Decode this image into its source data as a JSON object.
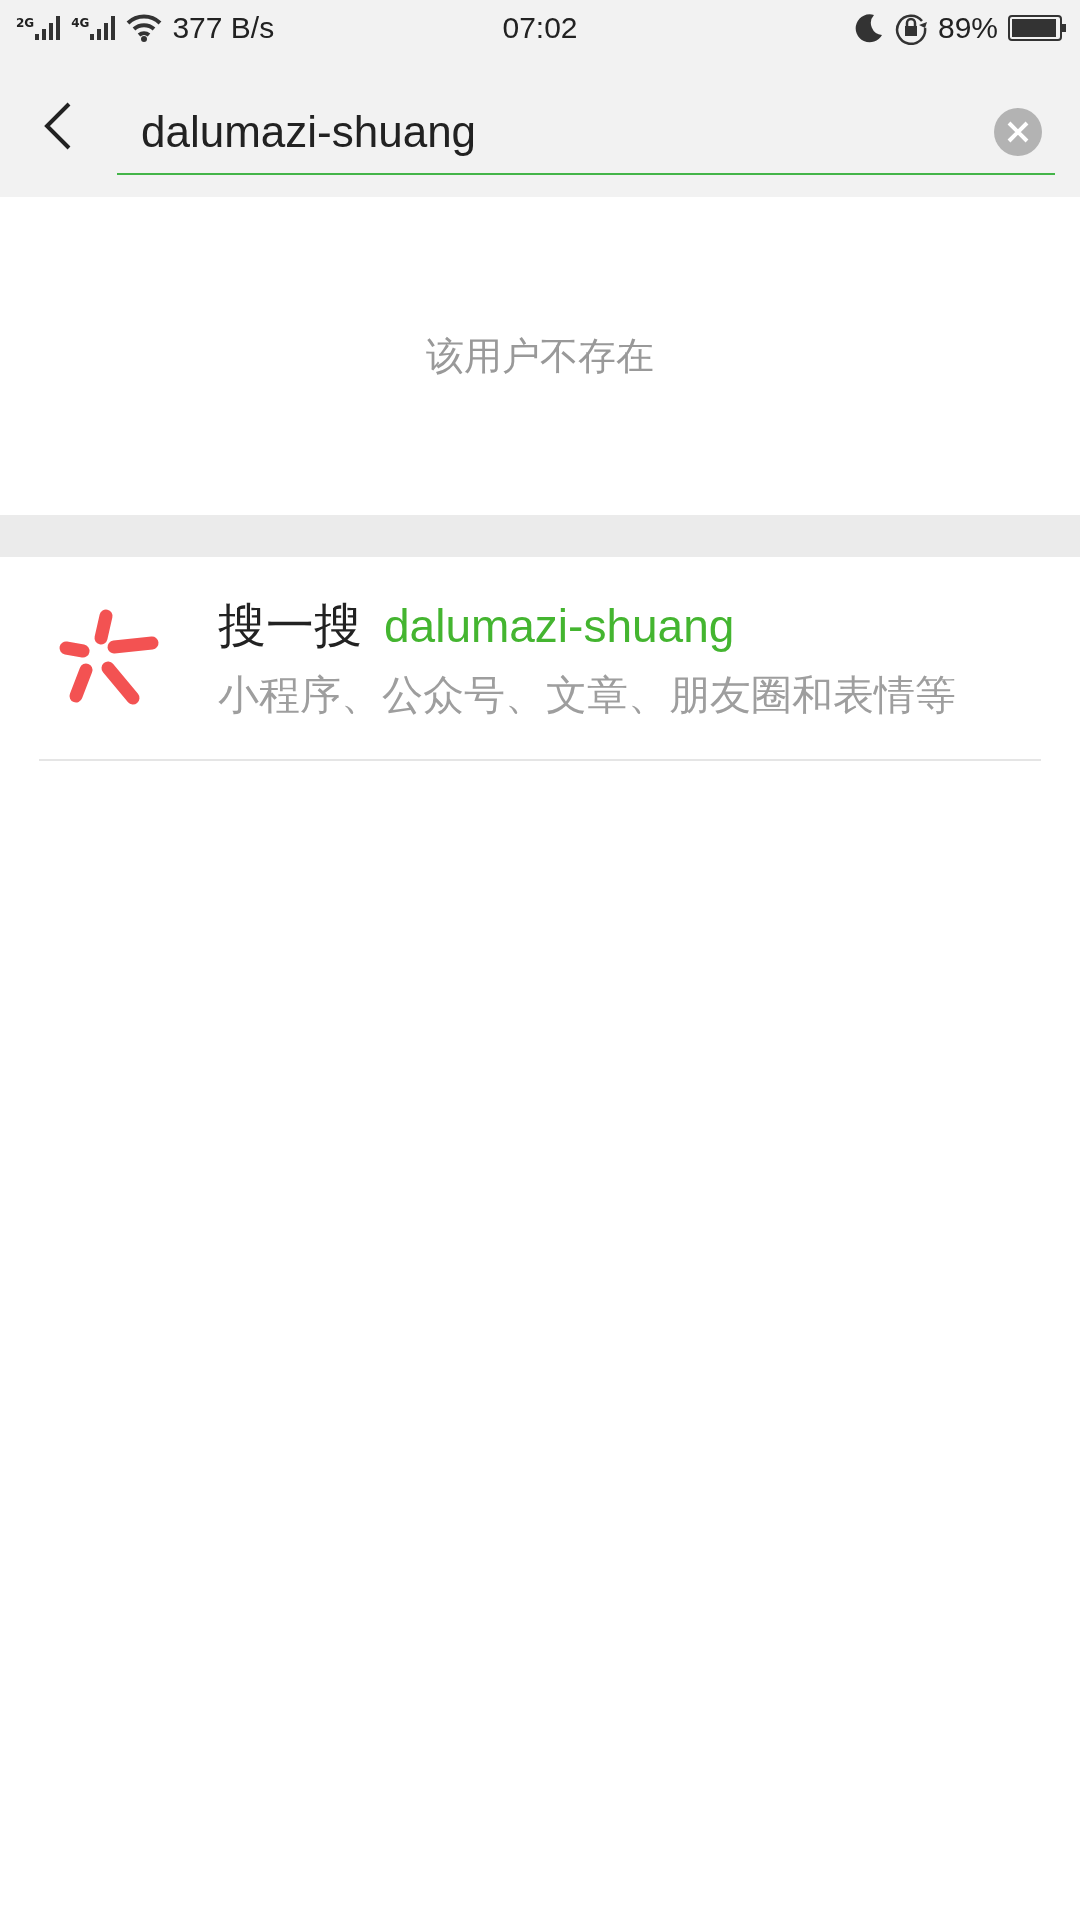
{
  "status_bar": {
    "sim_1": "2G",
    "sim_2": "4G",
    "speed": "377 B/s",
    "time": "07:02",
    "battery": "89%"
  },
  "search": {
    "value": "dalumazi-shuang"
  },
  "message": "该用户不存在",
  "result": {
    "label": "搜一搜",
    "query": "dalumazi-shuang",
    "subtitle": "小程序、公众号、文章、朋友圈和表情等"
  }
}
